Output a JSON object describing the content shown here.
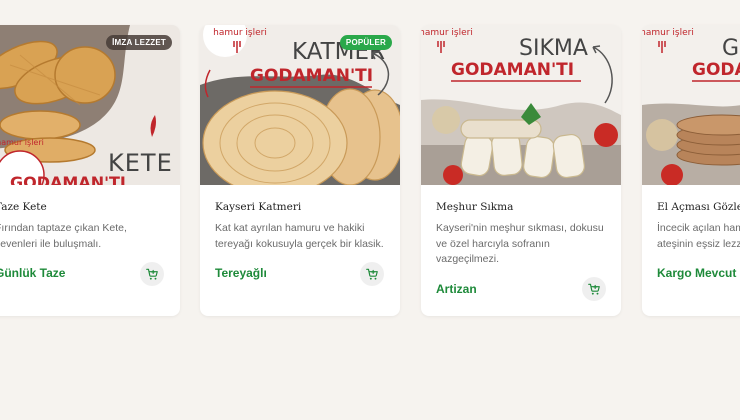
{
  "products": [
    {
      "title": "Taze Kete",
      "description": "Fırından taptaze çıkan Kete, sevenleri ile buluşmalı.",
      "tag": "Günlük Taze",
      "badge": "İMZA LEZZET",
      "image_brand": "hamur işleri",
      "image_heading": "KETE",
      "image_logo": "GODAMAN'TI"
    },
    {
      "title": "Kayseri Katmeri",
      "description": "Kat kat ayrılan hamuru ve hakiki tereyağı kokusuyla gerçek bir klasik.",
      "tag": "Tereyağlı",
      "badge": "POPÜLER",
      "image_brand": "hamur işleri",
      "image_heading": "KATMER",
      "image_logo": "GODAMAN'TI"
    },
    {
      "title": "Meşhur Sıkma",
      "description": "Kayseri'nin meşhur sıkması, dokusu ve özel harcıyla sofranın vazgeçilmezi.",
      "tag": "Artizan",
      "badge": "",
      "image_brand": "hamur işleri",
      "image_heading": "SIKMA",
      "image_logo": "GODAMAN'TI"
    },
    {
      "title": "El Açması Gözleme",
      "description": "İncecik açılan hamuru ve sac ateşinin eşsiz lezzeti.",
      "tag": "Kargo Mevcut",
      "badge": "",
      "image_brand": "hamur işleri",
      "image_heading": "GÖZLEME",
      "image_logo": "GODAMAN'TI"
    }
  ],
  "icons": {
    "cart": "add-to-cart-icon",
    "fork": "fork-icon"
  },
  "colors": {
    "accent_green": "#1e8a3a",
    "badge_green": "#2aa84a",
    "logo_red": "#c0262c"
  }
}
